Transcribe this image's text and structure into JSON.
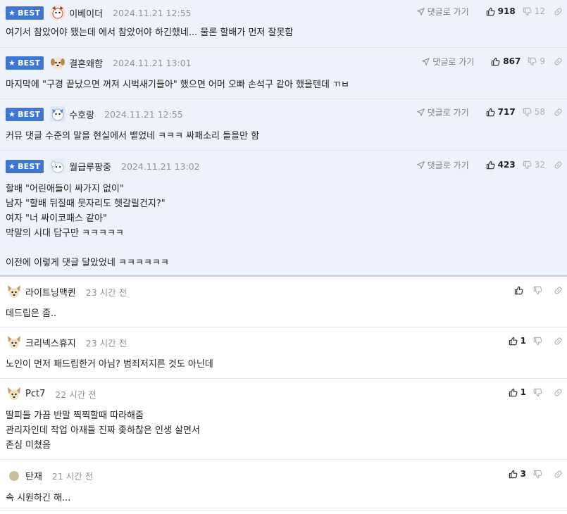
{
  "best_label": "BEST",
  "reply_label": "댓글로 가기",
  "best_comments": [
    {
      "nickname": "이베이더",
      "time": "2024.11.21 12:55",
      "up": "918",
      "down": "12",
      "lines": [
        "여기서 참았어야 됐는데 에서 참았어야 하긴했네... 물론 할배가 먼저 잘못함"
      ]
    },
    {
      "nickname": "결혼왜함",
      "time": "2024.11.21 13:01",
      "up": "867",
      "down": "9",
      "lines": [
        "마지막에 \"구경 끝났으면 꺼져 시벅새기들아\" 했으면 어머 오빠 손석구 같아 했을텐데 ㄲㅂ"
      ]
    },
    {
      "nickname": "수호랑",
      "time": "2024.11.21 12:55",
      "up": "717",
      "down": "58",
      "lines": [
        "커뮤 댓글 수준의 말을 현실에서 뱉었네 ㅋㅋㅋ 싸패소리 들을만 함"
      ]
    },
    {
      "nickname": "월급루팡중",
      "time": "2024.11.21 13:02",
      "up": "423",
      "down": "32",
      "lines": [
        "할배 \"어린애들이 싸가지 없이\"",
        "남자 \"할배 뒤질때 뭇자리도 헷갈릴건지?\"",
        "여자 \"너 싸이코패스 같아\"",
        "막말의 시대 답구만 ㅋㅋㅋㅋㅋ",
        "",
        "이전에 이렇게 댓글 달았었네 ㅋㅋㅋㅋㅋㅋ"
      ]
    }
  ],
  "comments": [
    {
      "nickname": "라이트닝맥퀸",
      "time": "23 시간 전",
      "up": "",
      "lines": [
        "데드립은 좀.."
      ]
    },
    {
      "nickname": "크리넥스휴지",
      "time": "23 시간 전",
      "up": "1",
      "lines": [
        "노인이 먼저 패드립한거 아님? 범죄저지른 것도 아닌데"
      ]
    },
    {
      "nickname": "Pct7",
      "time": "22 시간 전",
      "up": "1",
      "lines": [
        "딸피들 가끔 반말 찍찍할때 따라해줌",
        "관리자인데 작업 아재들 진짜 좆하찮은 인생 살면서",
        "존심 미쳤음"
      ]
    },
    {
      "nickname": "탄재",
      "time": "21 시간 전",
      "up": "3",
      "lines": [
        "속 시원하긴 해..."
      ]
    }
  ],
  "icons": {
    "best_star": "star-icon",
    "reply": "send-arrow-icon",
    "upvote": "thumbs-up-icon",
    "downvote": "thumbs-down-icon",
    "link": "link-icon",
    "avatar": "user-avatar"
  },
  "colors": {
    "best_badge": "#3d77d6",
    "best_background": "#eef2fb",
    "muted_text": "#8b93a0"
  }
}
